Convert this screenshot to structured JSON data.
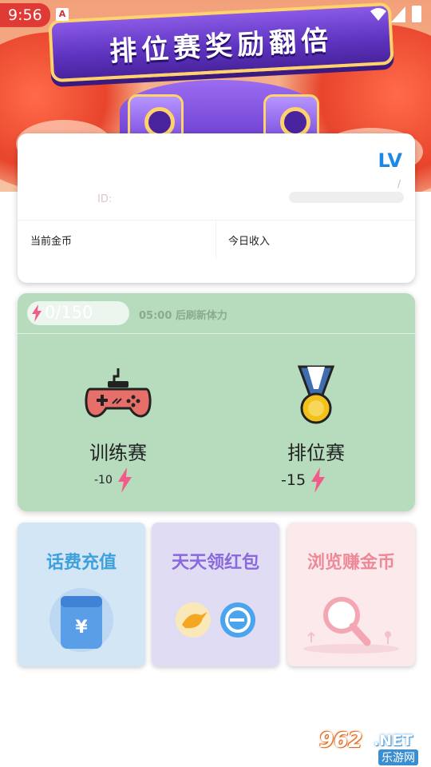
{
  "status_bar": {
    "time": "9:56"
  },
  "banner": {
    "title": "排位赛奖励翻倍"
  },
  "profile": {
    "level_label": "LV",
    "slash": "/",
    "id_label": "ID:",
    "coins_label": "当前金币",
    "income_label": "今日收入"
  },
  "energy": {
    "value": "0/150",
    "refresh_text": "05:00 后刷新体力"
  },
  "modes": [
    {
      "label": "训练赛",
      "cost": "-10",
      "icon": "gamepad-icon"
    },
    {
      "label": "排位赛",
      "cost": "-15",
      "icon": "medal-icon"
    }
  ],
  "tiles": [
    {
      "title": "话费充值",
      "icon": "wallet-yuan-icon"
    },
    {
      "title": "天天领红包",
      "icon": "bird-and-e-icon"
    },
    {
      "title": "浏览赚金币",
      "icon": "magnifier-icon"
    }
  ],
  "watermark": {
    "brand": "962",
    "domain": ".NET",
    "sub": "乐游网"
  },
  "colors": {
    "accent_blue": "#1e88e5",
    "game_card_green": "#b6dcbd",
    "bolt_pink": "#f25a8a"
  }
}
